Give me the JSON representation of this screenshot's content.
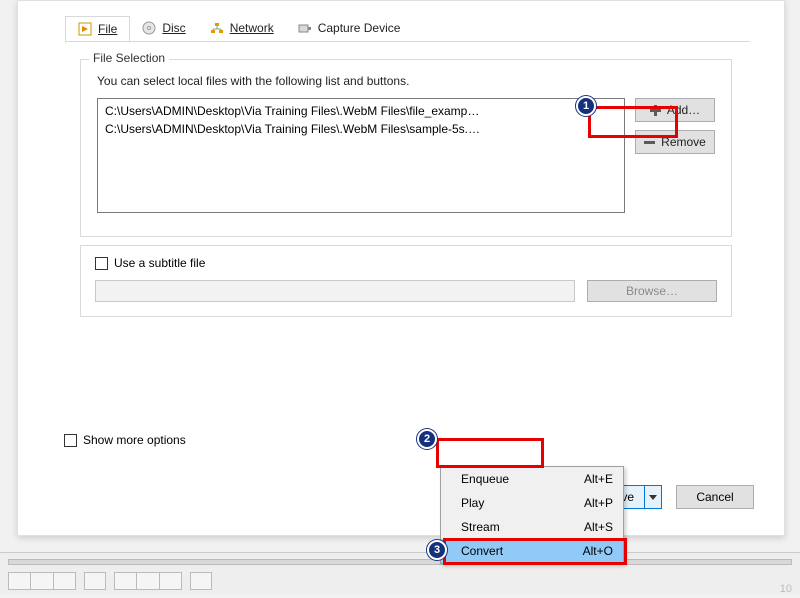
{
  "tabs": {
    "file": "File",
    "disc": "Disc",
    "network": "Network",
    "capture": "Capture Device"
  },
  "fileSelection": {
    "legend": "File Selection",
    "help": "You can select local files with the following list and buttons.",
    "files": [
      "C:\\Users\\ADMIN\\Desktop\\Via Training Files\\.WebM Files\\file_examp…",
      "C:\\Users\\ADMIN\\Desktop\\Via Training Files\\.WebM Files\\sample-5s.…"
    ],
    "addLabel": "Add…",
    "removeLabel": "Remove"
  },
  "subtitle": {
    "checkboxLabel": "Use a subtitle file",
    "browseLabel": "Browse…"
  },
  "showMoreLabel": "Show more options",
  "convertSaveLabel": "Convert / Save",
  "cancelLabel": "Cancel",
  "menu": {
    "enqueue": {
      "label": "Enqueue",
      "accel": "Alt+E"
    },
    "play": {
      "label": "Play",
      "accel": "Alt+P"
    },
    "stream": {
      "label": "Stream",
      "accel": "Alt+S"
    },
    "convert": {
      "label": "Convert",
      "accel": "Alt+O"
    }
  },
  "annotations": {
    "n1": "1",
    "n2": "2",
    "n3": "3"
  },
  "pageNumber": "10"
}
